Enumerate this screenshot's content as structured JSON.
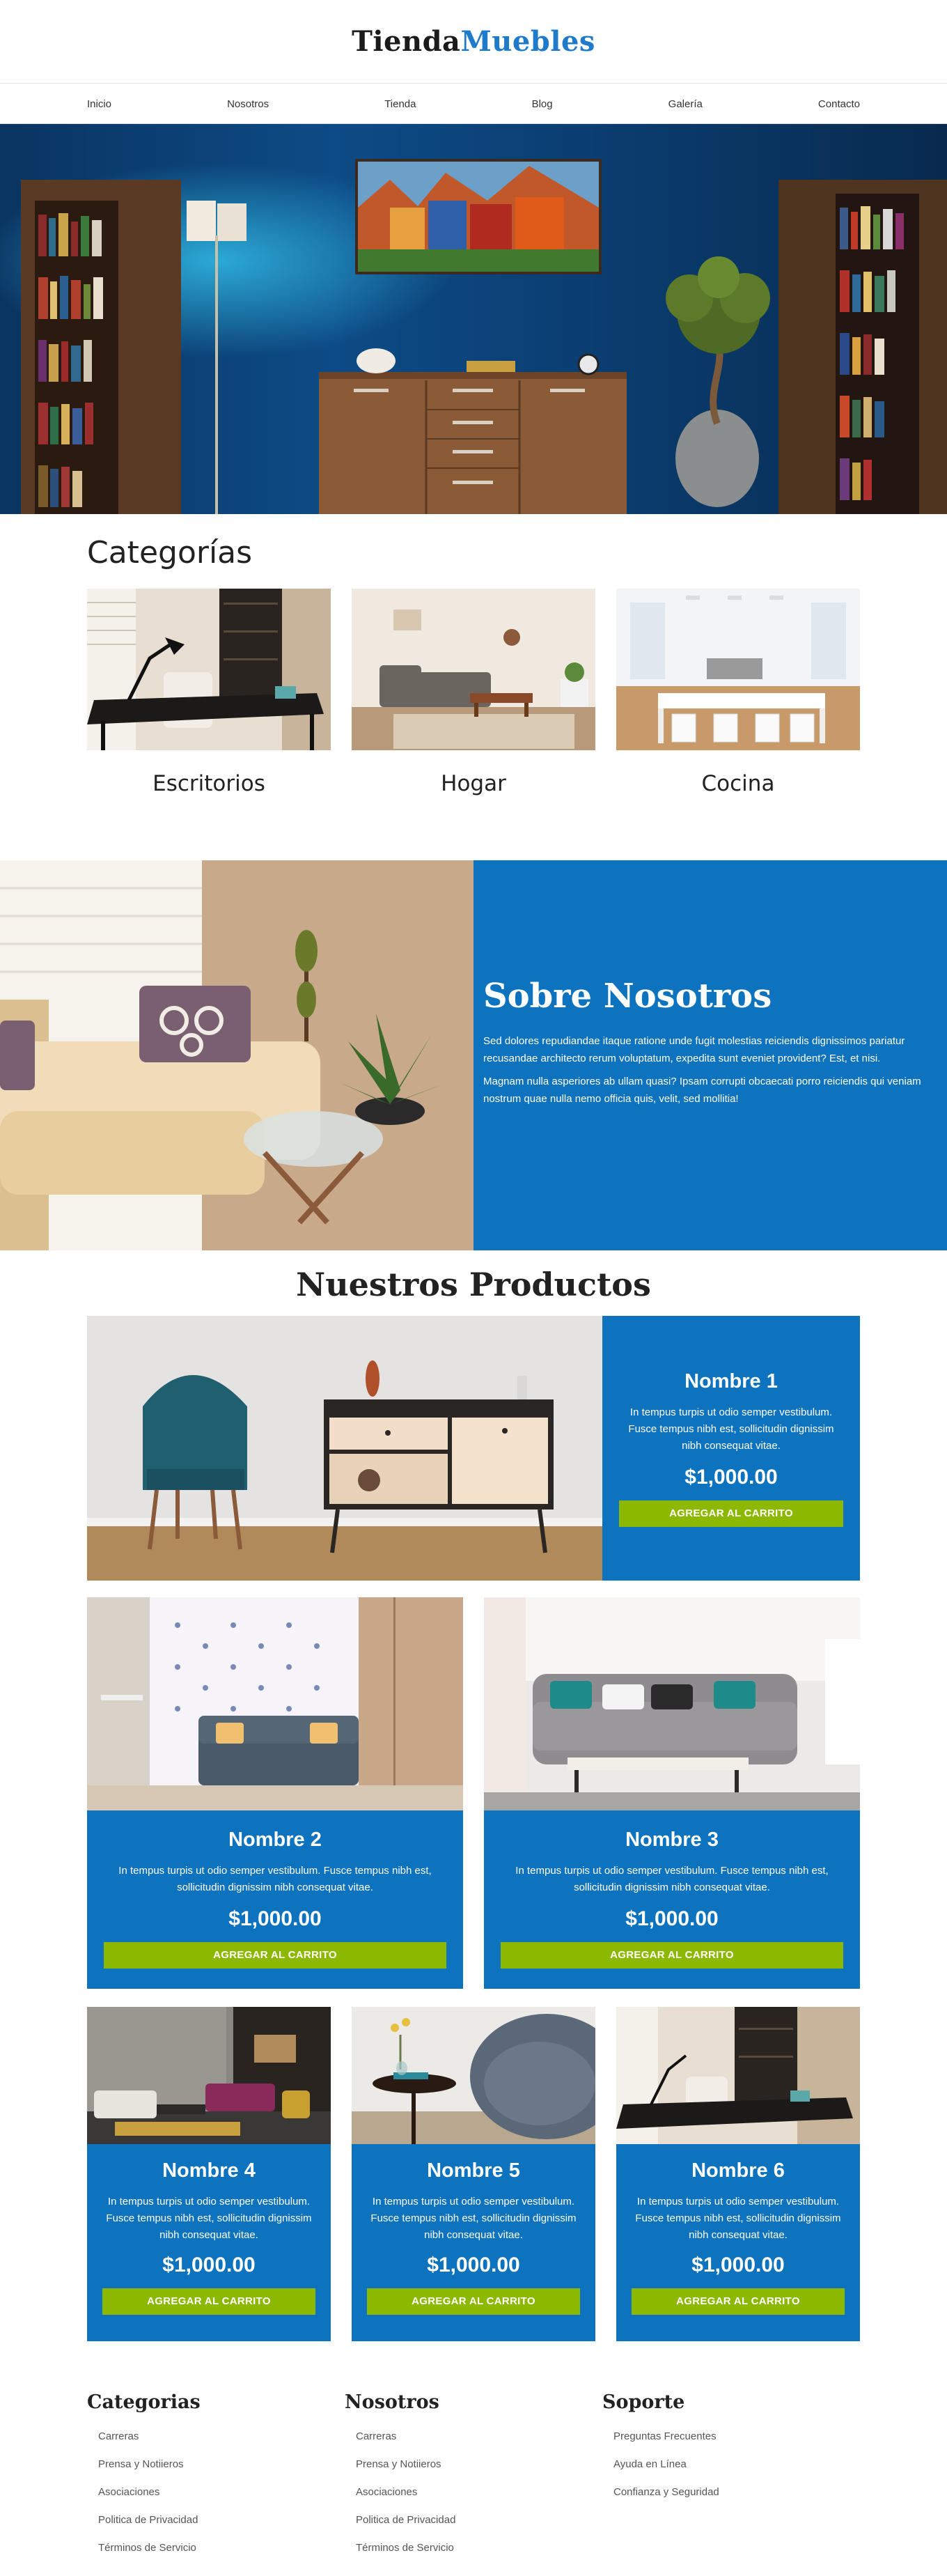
{
  "brand": {
    "part1": "Tienda",
    "part2": "Muebles",
    "accent_color": "#1f7bc9"
  },
  "nav": {
    "items": [
      "Inicio",
      "Nosotros",
      "Tienda",
      "Blog",
      "Galería",
      "Contacto"
    ]
  },
  "categories": {
    "title": "Categorías",
    "items": [
      "Escritorios",
      "Hogar",
      "Cocina"
    ]
  },
  "about": {
    "title": "Sobre Nosotros",
    "p1": "Sed dolores repudiandae itaque ratione unde fugit molestias reiciendis dignissimos pariatur recusandae architecto rerum voluptatum, expedita sunt eveniet provident? Est, et nisi.",
    "p2": "Magnam nulla asperiores ab ullam quasi? Ipsam corrupti obcaecati porro reiciendis qui veniam nostrum quae nulla nemo officia quis, velit, sed mollitia!",
    "bg_color": "#0e73bf"
  },
  "products": {
    "title": "Nuestros Productos",
    "button_label": "AGREGAR AL CARRITO",
    "button_color": "#8cb800",
    "items": [
      {
        "name": "Nombre 1",
        "desc": "In tempus turpis ut odio semper vestibulum. Fusce tempus nibh est, sollicitudin dignissim nibh consequat vitae.",
        "price": "$1,000.00"
      },
      {
        "name": "Nombre 2",
        "desc": "In tempus turpis ut odio semper vestibulum. Fusce tempus nibh est, sollicitudin dignissim nibh consequat vitae.",
        "price": "$1,000.00"
      },
      {
        "name": "Nombre 3",
        "desc": "In tempus turpis ut odio semper vestibulum. Fusce tempus nibh est, sollicitudin dignissim nibh consequat vitae.",
        "price": "$1,000.00"
      },
      {
        "name": "Nombre 4",
        "desc": "In tempus turpis ut odio semper vestibulum. Fusce tempus nibh est, sollicitudin dignissim nibh consequat vitae.",
        "price": "$1,000.00"
      },
      {
        "name": "Nombre 5",
        "desc": "In tempus turpis ut odio semper vestibulum. Fusce tempus nibh est, sollicitudin dignissim nibh consequat vitae.",
        "price": "$1,000.00"
      },
      {
        "name": "Nombre 6",
        "desc": "In tempus turpis ut odio semper vestibulum. Fusce tempus nibh est, sollicitudin dignissim nibh consequat vitae.",
        "price": "$1,000.00"
      }
    ]
  },
  "footer": {
    "columns": [
      {
        "title": "Categorias",
        "links": [
          "Carreras",
          "Prensa y Notiieros",
          "Asociaciones",
          "Politica de Privacidad",
          "Términos de Servicio"
        ]
      },
      {
        "title": "Nosotros",
        "links": [
          "Carreras",
          "Prensa y Notiieros",
          "Asociaciones",
          "Politica de Privacidad",
          "Términos de Servicio"
        ]
      },
      {
        "title": "Soporte",
        "links": [
          "Preguntas Frecuentes",
          "Ayuda en Línea",
          "Confianza y Seguridad"
        ]
      }
    ]
  }
}
